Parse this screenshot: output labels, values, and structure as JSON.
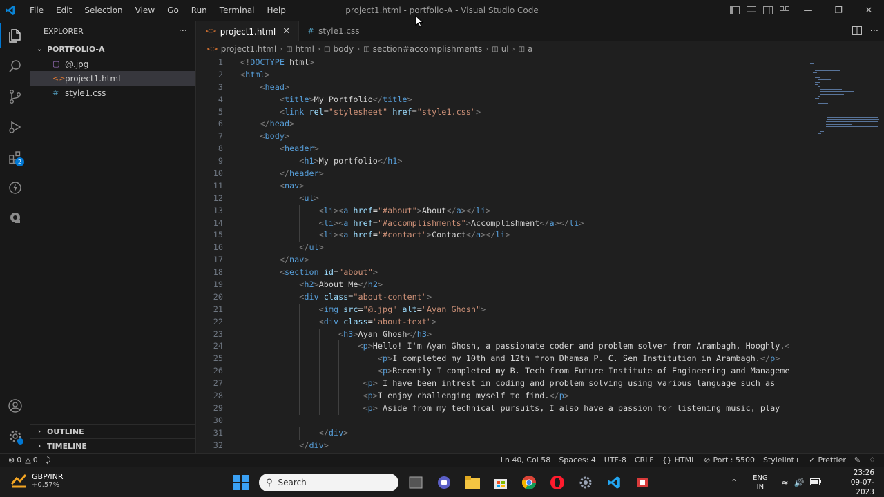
{
  "window": {
    "title": "project1.html - portfolio-A - Visual Studio Code",
    "menu": [
      "File",
      "Edit",
      "Selection",
      "View",
      "Go",
      "Run",
      "Terminal",
      "Help"
    ]
  },
  "activity": {
    "extensions_badge": "2"
  },
  "explorer": {
    "header": "EXPLORER",
    "more": "···",
    "folder": "PORTFOLIO-A",
    "files": [
      {
        "name": "@.jpg",
        "icon": "image-file-icon"
      },
      {
        "name": "project1.html",
        "icon": "html-file-icon"
      },
      {
        "name": "style1.css",
        "icon": "css-file-icon"
      }
    ],
    "outline": "OUTLINE",
    "timeline": "TIMELINE"
  },
  "tabs": [
    {
      "label": "project1.html",
      "active": true
    },
    {
      "label": "style1.css",
      "active": false
    }
  ],
  "breadcrumb": [
    "project1.html",
    "html",
    "body",
    "section#accomplishments",
    "ul",
    "a"
  ],
  "code_lines": [
    {
      "n": "1",
      "text": "<!DOCTYPE html>"
    },
    {
      "n": "2",
      "text": "<html>"
    },
    {
      "n": "3",
      "text": "    <head>"
    },
    {
      "n": "4",
      "text": "        <title>My Portfolio</title>"
    },
    {
      "n": "5",
      "text": "        <link rel=\"stylesheet\" href=\"style1.css\">"
    },
    {
      "n": "6",
      "text": "    </head>"
    },
    {
      "n": "7",
      "text": "    <body>"
    },
    {
      "n": "8",
      "text": "        <header>"
    },
    {
      "n": "9",
      "text": "            <h1>My portfolio</h1>"
    },
    {
      "n": "10",
      "text": "        </header>"
    },
    {
      "n": "11",
      "text": "        <nav>"
    },
    {
      "n": "12",
      "text": "            <ul>"
    },
    {
      "n": "13",
      "text": "                <li><a href=\"#about\">About</a></li>"
    },
    {
      "n": "14",
      "text": "                <li><a href=\"#accomplishments\">Accomplishment</a></li>"
    },
    {
      "n": "15",
      "text": "                <li><a href=\"#contact\">Contact</a></li>"
    },
    {
      "n": "16",
      "text": "            </ul>"
    },
    {
      "n": "17",
      "text": "        </nav>"
    },
    {
      "n": "18",
      "text": "        <section id=\"about\">"
    },
    {
      "n": "19",
      "text": "            <h2>About Me</h2>"
    },
    {
      "n": "20",
      "text": "            <div class=\"about-content\">"
    },
    {
      "n": "21",
      "text": "                <img src=\"@.jpg\" alt=\"Ayan Ghosh\">"
    },
    {
      "n": "22",
      "text": "                <div class=\"about-text\">"
    },
    {
      "n": "23",
      "text": "                    <h3>Ayan Ghosh</h3>"
    },
    {
      "n": "24",
      "text": "                        <p>Hello! I'm Ayan Ghosh, a passionate coder and problem solver from Arambagh, Hooghly.<"
    },
    {
      "n": "25",
      "text": "                            <p>I completed my 10th and 12th from Dhamsa P. C. Sen Institution in Arambagh.</p>"
    },
    {
      "n": "26",
      "text": "                            <p>Recently I completed my B. Tech from Future Institute of Engineering and Manageme"
    },
    {
      "n": "27",
      "text": "                         <p> I have been intrest in coding and problem solving using various language such as"
    },
    {
      "n": "28",
      "text": "                         <p>I enjoy challenging myself to find.</p>"
    },
    {
      "n": "29",
      "text": "                         <p> Aside from my technical pursuits, I also have a passion for listening music, play"
    },
    {
      "n": "30",
      "text": ""
    },
    {
      "n": "31",
      "text": "                </div>"
    },
    {
      "n": "32",
      "text": "            </div>"
    }
  ],
  "status": {
    "errors": "0",
    "warnings": "0",
    "position": "Ln 40, Col 58",
    "spaces": "Spaces: 4",
    "encoding": "UTF-8",
    "eol": "CRLF",
    "language": "HTML",
    "port": "Port : 5500",
    "stylelint": "Stylelint+",
    "prettier": "Prettier"
  },
  "taskbar": {
    "widget_title": "GBP/INR",
    "widget_value": "+0.57%",
    "search_placeholder": "Search",
    "lang_top": "ENG",
    "lang_bottom": "IN",
    "time": "23:26",
    "date": "09-07-2023"
  },
  "colors": {
    "accent": "#0078d4",
    "tag": "#569cd6",
    "attr": "#9cdcfe",
    "string": "#ce9178",
    "text": "#d4d4d4"
  }
}
